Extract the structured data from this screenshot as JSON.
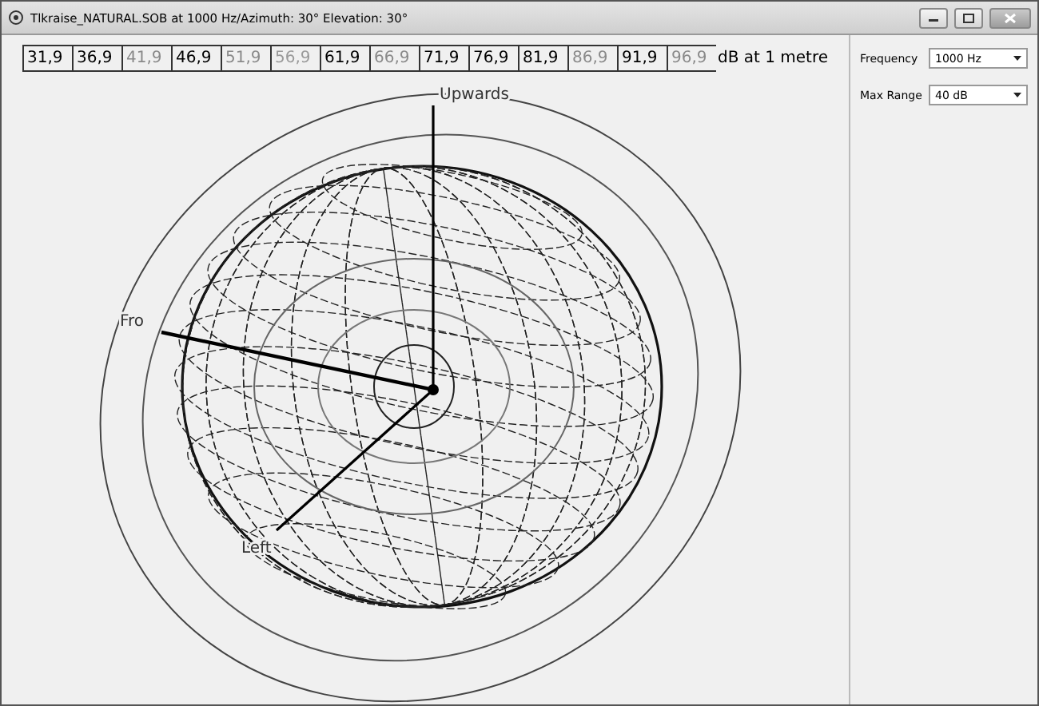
{
  "window": {
    "title": "Tlkraise_NATURAL.SOB at 1000 Hz/Azimuth: 30° Elevation: 30°"
  },
  "scale": {
    "steps": [
      {
        "label": "31,9",
        "color": "#000000"
      },
      {
        "label": "36,9",
        "color": "#000000"
      },
      {
        "label": "41,9",
        "color": "#8a8a8a"
      },
      {
        "label": "46,9",
        "color": "#000000"
      },
      {
        "label": "51,9",
        "color": "#8a8a8a"
      },
      {
        "label": "56,9",
        "color": "#9a9a9a"
      },
      {
        "label": "61,9",
        "color": "#000000"
      },
      {
        "label": "66,9",
        "color": "#8a8a8a"
      },
      {
        "label": "71,9",
        "color": "#000000"
      },
      {
        "label": "76,9",
        "color": "#000000"
      },
      {
        "label": "81,9",
        "color": "#000000"
      },
      {
        "label": "86,9",
        "color": "#8a8a8a"
      },
      {
        "label": "91,9",
        "color": "#000000"
      },
      {
        "label": "96,9",
        "color": "#8a8a8a"
      }
    ],
    "unit": "dB at 1 metre"
  },
  "axes": {
    "front": "Fro",
    "up": "Upwards",
    "left": "Left"
  },
  "controls": [
    {
      "label": "Frequency",
      "value": "1000 Hz"
    },
    {
      "label": "Max Range",
      "value": "40 dB"
    }
  ]
}
